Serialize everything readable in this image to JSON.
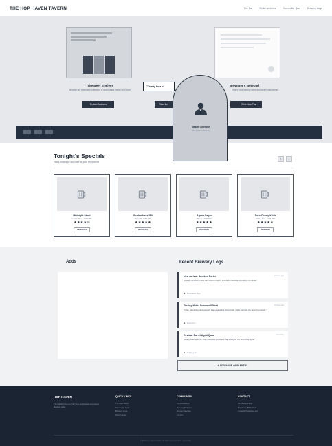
{
  "header": {
    "brand": "THE HOP HAVEN TAVERN",
    "nav": [
      "The Bar",
      "Cellar Archives",
      "Sommelier Quiz",
      "Brewery Logs"
    ]
  },
  "hero": {
    "left_title": "The Beer Shelves",
    "left_sub": "Browse our extensive collection of world-class brews and more.",
    "left_button": "Explore Archives",
    "quote": "\"Thirsty for a ne",
    "middle_button": "Take the",
    "right_title": "Brewster's Notepad",
    "right_sub": "Share your tasting notes and tavern discoveries.",
    "right_button": "Write New Post",
    "master_name": "Master Cicerone",
    "master_sub": "Your guide to the taps"
  },
  "specials": {
    "title": "Tonight's Specials",
    "subtitle": "Hand-picked by our staff for your enjoyment",
    "prev_icon": "‹",
    "next_icon": "›",
    "items": [
      {
        "name": "Midnight Stout",
        "meta": "Imperial Stout · 9.2% ABV",
        "stars": "★★★★½",
        "button": "VIEW DATA"
      },
      {
        "name": "Golden Haze IPA",
        "meta": "Hazy IPA · 6.8% ABV",
        "stars": "★★★★★",
        "button": "VIEW DATA"
      },
      {
        "name": "Alpine Lager",
        "meta": "Pilsner · 4.9% ABV",
        "stars": "★★★★★",
        "button": "VIEW DATA"
      },
      {
        "name": "Sour Cherry Kriek",
        "meta": "Fruited Sour · 5.5% ABV",
        "stars": "★★★★★",
        "button": "VIEW DATA"
      }
    ]
  },
  "adds": {
    "title": "Adds"
  },
  "logs": {
    "title": "Recent Brewery Logs",
    "entries": [
      {
        "title": "New Arrival: Smoked Porter",
        "date": "2 hours ago",
        "body": "\"A deep, complex profile with hints of hickory and dark chocolate. A must-try for winter!\"",
        "author": "Brewmaster Jack"
      },
      {
        "title": "Tasting Note: Summer Wheat",
        "date": "5 hours ago",
        "body": "\"Crisp, refreshing, and perfectly balanced with a citrus finish. Pairs well with the tavern's pretzels.\"",
        "author": "Sarah Finn"
      },
      {
        "title": "Review: Barrel Aged Quad",
        "date": "Yesterday",
        "body": "\"Heavy hitter at 11% - fruity notes are prominent. Sip slowly for the end of the night!\"",
        "author": "The Regulars"
      }
    ],
    "add_button": "+ ADD YOUR OWN ENTRY"
  },
  "footer": {
    "brand": "HOP HAVEN",
    "tagline": "The digital home for craft beer enthusiasts and tavern dwellers alike.",
    "quick_links": {
      "title": "QUICK LINKS",
      "items": [
        "The Beer Shelf",
        "Sommelier Quiz",
        "Brewery Logs",
        "Tavern Rules"
      ]
    },
    "community": {
      "title": "COMMUNITY",
      "items": [
        "Top Reviewers",
        "Brewery Partners",
        "Events Calendar",
        "Forums"
      ]
    },
    "contact": {
      "title": "CONTACT",
      "items": [
        "123 Barley Lane",
        "Brewtown, BT 10442",
        "contact@hophaven.com"
      ]
    },
    "copyright": "© 2024 Hop Haven Tavern. All rights reserved. Drink responsibly."
  },
  "colors": {
    "dark": "#1b2432",
    "hero_bg": "#e6e8eb",
    "card_border": "#4b5563"
  },
  "icons": {
    "beer_mug": "beer-mug-icon",
    "avatar": "user-avatar-icon",
    "author": "user-icon"
  }
}
